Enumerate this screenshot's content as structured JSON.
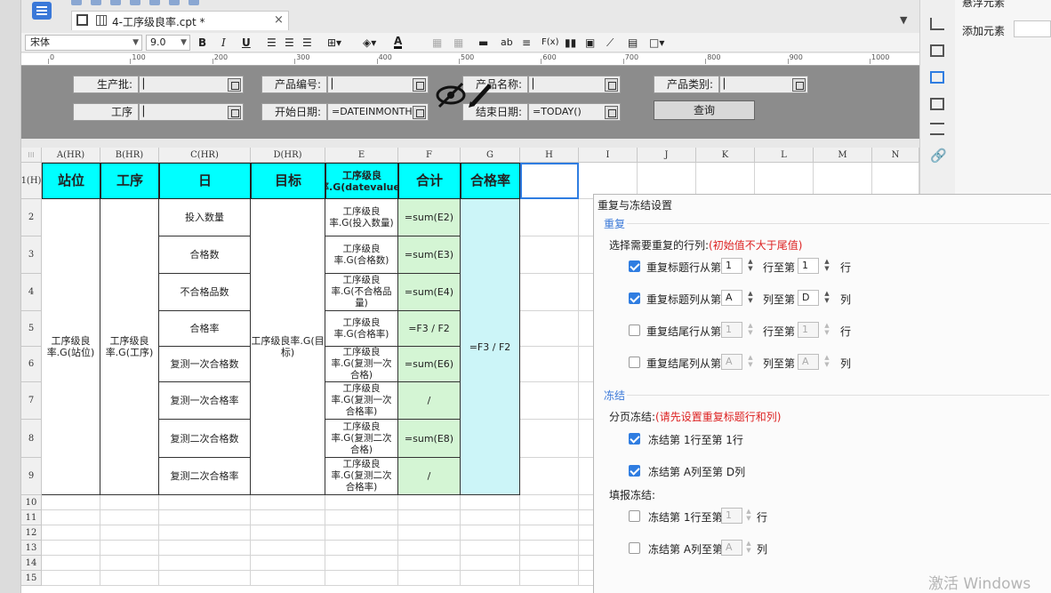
{
  "tab": {
    "title": "4-工序级良率.cpt *",
    "close": "×"
  },
  "toolbar": {
    "font": "宋体",
    "size": "9.0",
    "bold": "B",
    "italic": "I",
    "underline": "U",
    "ab": "ab",
    "fx": "F(x)",
    "font_color_label": "A"
  },
  "ruler": [
    "0",
    "100",
    "200",
    "300",
    "400",
    "500",
    "600",
    "700",
    "800",
    "900",
    "1000"
  ],
  "params": {
    "batch_label": "生产批:",
    "product_no_label": "产品编号:",
    "product_name_label": "产品名称:",
    "product_type_label": "产品类别:",
    "process_label": "工序",
    "start_label": "开始日期:",
    "start_value": "=DATEINMONTH",
    "end_label": "结束日期:",
    "end_value": "=TODAY()",
    "query_button": "查询"
  },
  "columns": [
    "A(HR)",
    "B(HR)",
    "C(HR)",
    "D(HR)",
    "E",
    "F",
    "G",
    "H",
    "I",
    "J",
    "K",
    "L",
    "M",
    "N"
  ],
  "rows": [
    "1(H)",
    "2",
    "3",
    "4",
    "5",
    "6",
    "7",
    "8",
    "9",
    "10",
    "11",
    "12",
    "13",
    "14",
    "15"
  ],
  "table": {
    "h_station": "站位",
    "h_process": "工序",
    "h_day": "日",
    "h_target": "目标",
    "h_e": "工序级良率.G(datevalue)",
    "h_total": "合计",
    "h_rate": "合格率",
    "a_merged": "工序级良率.G(站位)",
    "b_merged": "工序级良率.G(工序)",
    "d_merged": "工序级良率.G(目标)",
    "g_merged": "=F3 / F2",
    "c_items": [
      "投入数量",
      "合格数",
      "不合格品数",
      "合格率",
      "复测一次合格数",
      "复测一次合格率",
      "复测二次合格数",
      "复测二次合格率"
    ],
    "e_items": [
      "工序级良率.G(投入数量)",
      "工序级良率.G(合格数)",
      "工序级良率.G(不合格品量)",
      "工序级良率.G(合格率)",
      "工序级良率.G(复测一次合格)",
      "工序级良率.G(复测一次合格率)",
      "工序级良率.G(复测二次合格)",
      "工序级良率.G(复测二次合格率)"
    ],
    "f_items": [
      "=sum(E2)",
      "=sum(E3)",
      "=sum(E4)",
      "=F3 / F2",
      "=sum(E6)",
      "/",
      "=sum(E8)",
      "/"
    ]
  },
  "right_panel": {
    "top_label": "悬浮元素",
    "add_label": "添加元素"
  },
  "dialog": {
    "title": "重复与冻结设置",
    "repeat_section": "重复",
    "repeat_hint": "选择需要重复的行列:",
    "repeat_hint_red": "(初始值不大于尾值)",
    "r1_label": "重复标题行从第",
    "r1_from": "1",
    "r1_mid": "行至第",
    "r1_to": "1",
    "r1_end": "行",
    "r2_label": "重复标题列从第",
    "r2_from": "A",
    "r2_mid": "列至第",
    "r2_to": "D",
    "r2_end": "列",
    "r3_label": "重复结尾行从第",
    "r3_from": "1",
    "r3_mid": "行至第",
    "r3_to": "1",
    "r3_end": "行",
    "r4_label": "重复结尾列从第",
    "r4_from": "A",
    "r4_mid": "列至第",
    "r4_to": "A",
    "r4_end": "列",
    "freeze_section": "冻结",
    "page_freeze": "分页冻结:",
    "page_freeze_red": "(请先设置重复标题行和列)",
    "f1_label": "冻结第 1行至第 1行",
    "f2_label": "冻结第 A列至第 D列",
    "fill_freeze": "填报冻结:",
    "f3_label": "冻结第 1行至第",
    "f3_val": "1",
    "f3_end": "行",
    "f4_label": "冻结第 A列至第",
    "f4_val": "A",
    "f4_end": "列"
  },
  "watermark": "激活 Windows"
}
